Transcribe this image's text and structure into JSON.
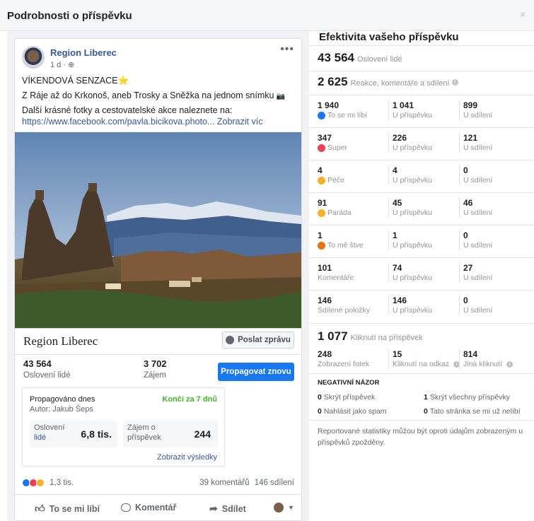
{
  "modal": {
    "title": "Podrobnosti o příspěvku",
    "close": "×"
  },
  "post": {
    "page_name": "Region Liberec",
    "meta": "1 d · ",
    "more": "•••",
    "headline": "VÍKENDOVÁ SENZACE",
    "headline_emoji": "⭐",
    "line2": "Z Ráje až do Krkonoš, aneb Trosky a Sněžka na jednom snímku",
    "line2_emoji": "📷",
    "line3": "Další krásné fotky a cestovatelské akce naleznete na:",
    "link": "https://www.facebook.com/pavla.bicikova.photo...",
    "see_more": "Zobrazit víc"
  },
  "footer": {
    "page_name": "Region Liberec",
    "message_button": "Poslat zprávu",
    "reach_value": "43 564",
    "reach_label": "Oslovení lidé",
    "engagement_value": "3 702",
    "engagement_label": "Zájem",
    "promote_button": "Propagovat znovu"
  },
  "promo": {
    "title": "Propagováno dnes",
    "author": "Autor: Jakub Šeps",
    "ends": "Končí za 7 dnů",
    "m1_label1": "Oslovení",
    "m1_label2": "lidé",
    "m1_value": "6,8 tis.",
    "m2_label1": "Zájem o",
    "m2_label2": "příspěvek",
    "m2_value": "244",
    "results_link": "Zobrazit výsledky"
  },
  "social": {
    "reactions_count": "1,3 tis.",
    "comments": "39 komentářů",
    "shares": "146 sdílení",
    "like": "To se mi líbí",
    "comment": "Komentář",
    "share": "Sdílet"
  },
  "perf": {
    "title": "Efektivita vašeho příspěvku",
    "reach_value": "43 564",
    "reach_label": "Oslovení lidé",
    "reactions_value": "2 625",
    "reactions_label": "Reakce, komentáře a sdílení",
    "rows": [
      {
        "c1": "1 940",
        "c1l": "To se mi líbí",
        "icon": "like-icon",
        "color": "#1877f2",
        "c2": "1 041",
        "c2l": "U příspěvku",
        "c3": "899",
        "c3l": "U sdílení"
      },
      {
        "c1": "347",
        "c1l": "Super",
        "icon": "love-icon",
        "color": "#f33e58",
        "c2": "226",
        "c2l": "U příspěvku",
        "c3": "121",
        "c3l": "U sdílení"
      },
      {
        "c1": "4",
        "c1l": "Péče",
        "icon": "care-icon",
        "color": "#f7b125",
        "c2": "4",
        "c2l": "U příspěvku",
        "c3": "0",
        "c3l": "U sdílení"
      },
      {
        "c1": "91",
        "c1l": "Paráda",
        "icon": "wow-icon",
        "color": "#f7b125",
        "c2": "45",
        "c2l": "U příspěvku",
        "c3": "46",
        "c3l": "U sdílení"
      },
      {
        "c1": "1",
        "c1l": "To mě štve",
        "icon": "angry-icon",
        "color": "#e9710f",
        "c2": "1",
        "c2l": "U příspěvku",
        "c3": "0",
        "c3l": "U sdílení"
      },
      {
        "c1": "101",
        "c1l": "Komentáře",
        "icon": "",
        "color": "",
        "c2": "74",
        "c2l": "U příspěvku",
        "c3": "27",
        "c3l": "U sdílení"
      },
      {
        "c1": "146",
        "c1l": "Sdílené položky",
        "icon": "",
        "color": "",
        "c2": "146",
        "c2l": "U příspěvku",
        "c3": "0",
        "c3l": "U sdílení"
      }
    ],
    "clicks_value": "1 077",
    "clicks_label": "Kliknutí na příspěvek",
    "photo_views": "248",
    "photo_views_label": "Zobrazení fotek",
    "link_clicks": "15",
    "link_clicks_label": "Kliknutí na odkaz",
    "other_clicks": "814",
    "other_clicks_label": "Jiná kliknutí",
    "neg_header": "NEGATIVNÍ NÁZOR",
    "hide_post_n": "0",
    "hide_post": "Skrýt příspěvek",
    "hide_all_n": "1",
    "hide_all": "Skrýt všechny příspěvky",
    "spam_n": "0",
    "spam": "Nahlásit jako spam",
    "unlike_n": "0",
    "unlike": "Tato stránka se mi už nelíbí",
    "footnote": "Reportované statistiky můžou být oproti údajům zobrazeným u příspěvků zpožděny."
  }
}
